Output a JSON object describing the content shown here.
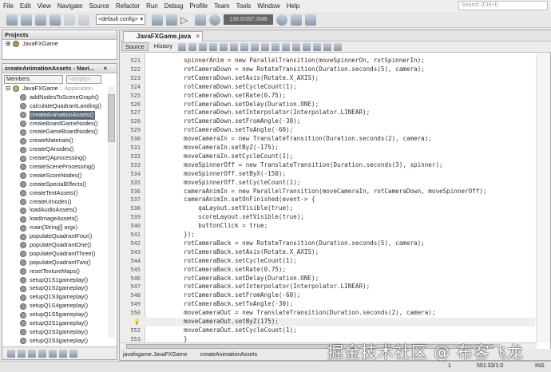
{
  "menu": [
    "File",
    "Edit",
    "View",
    "Navigate",
    "Source",
    "Refactor",
    "Run",
    "Debug",
    "Profile",
    "Team",
    "Tools",
    "Window",
    "Help"
  ],
  "search_placeholder": "Search (Ctrl+I)",
  "toolbar": {
    "config": "<default config>",
    "memory": "138.6/397.0MB"
  },
  "projects": {
    "title": "Projects",
    "root": "JavaFXGame"
  },
  "navigator": {
    "title": "createAnimationAssets - Navi...",
    "filter": "Members",
    "filter2": "<empty>",
    "root": "JavaFXGame",
    "root_suffix": ":: Application",
    "items": [
      "addNodesToSceneGraph()",
      "calculateQuadrantLanding()",
      "createAnimationAssets()",
      "createBoardGameNodes()",
      "createGameBoardNodes()",
      "createMaterials()",
      "createQAnodes()",
      "createQAprocessing()",
      "createSceneProcessing()",
      "createScoreNodes()",
      "createSpecialEffects()",
      "createTextAssets()",
      "createUInodes()",
      "loadAudioAssets()",
      "loadImageAssets()",
      "main(String[] args)",
      "populateQuadrantFour()",
      "populateQuadrantOne()",
      "populateQuadrantThree()",
      "populateQuadrantTwo()",
      "resetTextureMaps()",
      "setupQ1S1gameplay()",
      "setupQ1S2gameplay()",
      "setupQ1S3gameplay()",
      "setupQ1S4gameplay()",
      "setupQ1S5gameplay()",
      "setupQ2S1gameplay()",
      "setupQ2S2gameplay()",
      "setupQ2S3gameplay()"
    ],
    "selected_index": 2
  },
  "editor": {
    "tab": "JavaFXGame.java",
    "source": "Source",
    "history": "History",
    "lines": [
      {
        "n": "521",
        "t": "spinnerAnim = new ParallelTransition(moveSpinnerOn, rotSpinnerIn);"
      },
      {
        "n": "522",
        "t": "rotCameraDown = new RotateTransition(Duration.seconds(5), camera);"
      },
      {
        "n": "523",
        "t": "rotCameraDown.setAxis(Rotate.X_AXIS);"
      },
      {
        "n": "524",
        "t": "rotCameraDown.setCycleCount(1);"
      },
      {
        "n": "525",
        "t": "rotCameraDown.setRate(0.75);"
      },
      {
        "n": "526",
        "t": "rotCameraDown.setDelay(Duration.ONE);"
      },
      {
        "n": "527",
        "t": "rotCameraDown.setInterpolator(Interpolator.LINEAR);"
      },
      {
        "n": "528",
        "t": "rotCameraDown.setFromAngle(-30);"
      },
      {
        "n": "529",
        "t": "rotCameraDown.setToAngle(-60);"
      },
      {
        "n": "530",
        "t": "moveCameraIn = new TranslateTransition(Duration.seconds(2), camera);"
      },
      {
        "n": "531",
        "t": "moveCameraIn.setByZ(-175);"
      },
      {
        "n": "532",
        "t": "moveCameraIn.setCycleCount(1);"
      },
      {
        "n": "533",
        "t": "moveSpinnerOff = new TranslateTransition(Duration.seconds(3), spinner);"
      },
      {
        "n": "534",
        "t": "moveSpinnerOff.setByX(-150);"
      },
      {
        "n": "535",
        "t": "moveSpinnerOff.setCycleCount(1);"
      },
      {
        "n": "536",
        "t": "cameraAnimIn = new ParallelTransition(moveCameraIn, rotCameraDown, moveSpinnerOff);"
      },
      {
        "n": "537",
        "t": "cameraAnimIn.setOnFinished(event-> {"
      },
      {
        "n": "538",
        "t": "    qaLayout.setVisible(true);"
      },
      {
        "n": "539",
        "t": "    scoreLayout.setVisible(true);"
      },
      {
        "n": "540",
        "t": "    buttonClick = true;"
      },
      {
        "n": "541",
        "t": "});"
      },
      {
        "n": "542",
        "t": "rotCameraBack = new RotateTransition(Duration.seconds(5), camera);"
      },
      {
        "n": "543",
        "t": "rotCameraBack.setAxis(Rotate.X_AXIS);"
      },
      {
        "n": "544",
        "t": "rotCameraBack.setCycleCount(1);"
      },
      {
        "n": "545",
        "t": "rotCameraBack.setRate(0.75);"
      },
      {
        "n": "546",
        "t": "rotCameraBack.setDelay(Duration.ONE);"
      },
      {
        "n": "547",
        "t": "rotCameraBack.setInterpolator(Interpolator.LINEAR);"
      },
      {
        "n": "548",
        "t": "rotCameraBack.setFromAngle(-60);"
      },
      {
        "n": "549",
        "t": "rotCameraBack.setToAngle(-30);"
      },
      {
        "n": "550",
        "t": "moveCameraOut = new TranslateTransition(Duration.seconds(2), camera);"
      },
      {
        "n": "",
        "t": "moveCameraOut.setByZ(175);"
      },
      {
        "n": "552",
        "t": "moveCameraOut.setCycleCount(1);"
      },
      {
        "n": "553",
        "t": "}"
      }
    ]
  },
  "breadcrumb": [
    "javafxgame.JavaFXGame",
    "createAnimationAssets"
  ],
  "status": {
    "position": "551:33/1:3",
    "mode": "INS",
    "notifications": "1"
  },
  "watermark": "掘金技术社区 @ 布客飞龙"
}
